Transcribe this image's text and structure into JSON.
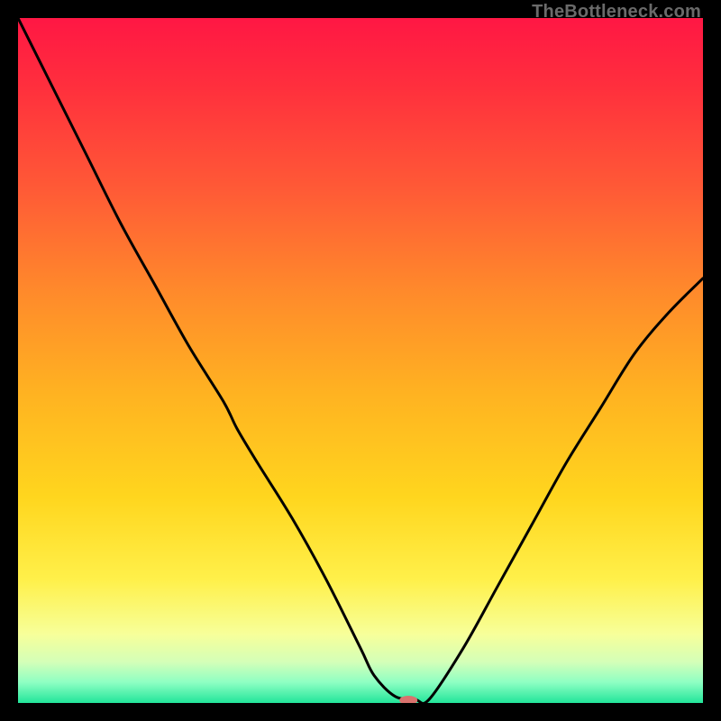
{
  "watermark": "TheBottleneck.com",
  "chart_data": {
    "type": "line",
    "title": "",
    "xlabel": "",
    "ylabel": "",
    "xlim": [
      0,
      100
    ],
    "ylim": [
      0,
      100
    ],
    "grid": false,
    "legend": false,
    "series": [
      {
        "name": "curve",
        "x": [
          0,
          5,
          10,
          15,
          20,
          25,
          30,
          32,
          35,
          40,
          45,
          50,
          52,
          55,
          58,
          60,
          65,
          70,
          75,
          80,
          85,
          90,
          95,
          100
        ],
        "y": [
          100,
          90,
          80,
          70,
          61,
          52,
          44,
          40,
          35,
          27,
          18,
          8,
          4,
          1,
          0.5,
          0.5,
          8,
          17,
          26,
          35,
          43,
          51,
          57,
          62
        ]
      }
    ],
    "marker": {
      "x": 57,
      "y": 0.4,
      "color": "#d9736e",
      "rx": 10,
      "ry": 5
    },
    "gradient_stops": [
      {
        "offset": 0.0,
        "color": "#ff1744"
      },
      {
        "offset": 0.1,
        "color": "#ff2f3d"
      },
      {
        "offset": 0.25,
        "color": "#ff5a36"
      },
      {
        "offset": 0.4,
        "color": "#ff8a2b"
      },
      {
        "offset": 0.55,
        "color": "#ffb321"
      },
      {
        "offset": 0.7,
        "color": "#ffd61e"
      },
      {
        "offset": 0.82,
        "color": "#fff04a"
      },
      {
        "offset": 0.9,
        "color": "#f7ff9a"
      },
      {
        "offset": 0.94,
        "color": "#d4ffb8"
      },
      {
        "offset": 0.97,
        "color": "#8effc3"
      },
      {
        "offset": 1.0,
        "color": "#22e59a"
      }
    ]
  }
}
